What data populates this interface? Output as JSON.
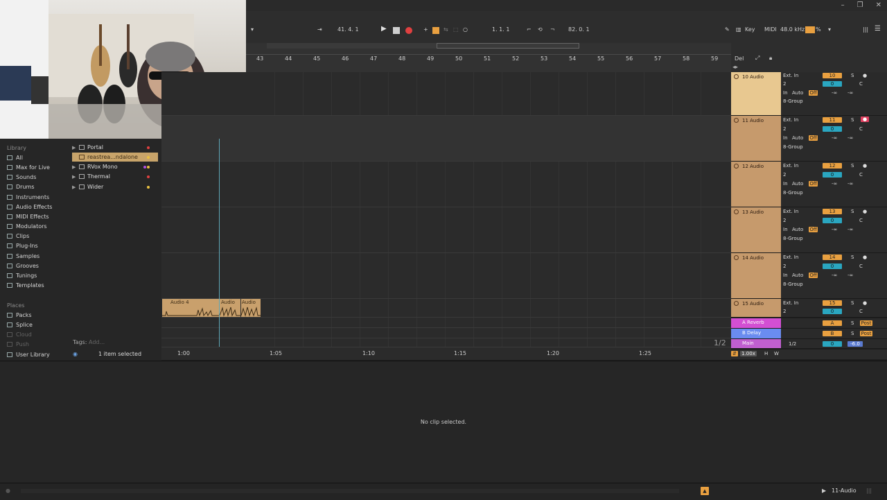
{
  "toolbar": {
    "position": "41.  4.  1",
    "loop_start": "1.  1.  1",
    "tempo_display": "82.  0.  1",
    "key_label": "Key",
    "midi_label": "MIDI",
    "sample_rate": "48.0 kHz",
    "cpu": "%"
  },
  "ruler": {
    "bars": [
      "43",
      "44",
      "45",
      "46",
      "47",
      "48",
      "49",
      "50",
      "51",
      "52",
      "53",
      "54",
      "55",
      "56",
      "57",
      "58",
      "59"
    ]
  },
  "browser": {
    "library_label": "Library",
    "categories": [
      "All",
      "Max for Live",
      "Sounds",
      "Drums",
      "Instruments",
      "Audio Effects",
      "MIDI Effects",
      "Modulators",
      "Clips",
      "Plug-Ins",
      "Samples",
      "Grooves",
      "Tunings",
      "Templates"
    ],
    "places_label": "Places",
    "places": [
      "Packs",
      "Splice",
      "Cloud",
      "Push",
      "User Library"
    ],
    "files": [
      "Portal",
      "reastrea...ndalone",
      "RVox Mono",
      "Thermal",
      "Wider"
    ],
    "tags_label": "Tags:",
    "tags_placeholder": "Add...",
    "selection_status": "1 item selected"
  },
  "tracks": [
    {
      "name": "10 Audio",
      "input": "Ext. In",
      "channel": "2",
      "group": "8-Group",
      "num": "10"
    },
    {
      "name": "11 Audio",
      "input": "Ext. In",
      "channel": "2",
      "group": "8-Group",
      "num": "11"
    },
    {
      "name": "12 Audio",
      "input": "Ext. In",
      "channel": "2",
      "group": "8-Group",
      "num": "12"
    },
    {
      "name": "13 Audio",
      "input": "Ext. In",
      "channel": "2",
      "group": "8-Group",
      "num": "13"
    },
    {
      "name": "14 Audio",
      "input": "Ext. In",
      "channel": "2",
      "group": "8-Group",
      "num": "14"
    },
    {
      "name": "15 Audio",
      "input": "Ext. In",
      "channel": "2",
      "num": "15"
    }
  ],
  "track_controls": {
    "in": "In",
    "auto": "Auto",
    "off": "Off",
    "inf": "-∞",
    "solo": "S",
    "center": "C",
    "zero": "0"
  },
  "returns": [
    {
      "name": "A Reverb",
      "letter": "A",
      "post": "Post",
      "color": "#d34fd3"
    },
    {
      "name": "B Delay",
      "letter": "B",
      "post": "Post",
      "color": "#6a8cf0"
    },
    {
      "name": "Main",
      "page": "1/2",
      "vol": "-6.0",
      "color": "#c05fd0"
    }
  ],
  "arrange_header": {
    "del": "Del"
  },
  "clip": {
    "name": "Audio 4",
    "name2": "Audio",
    "name3": "Audio"
  },
  "page_indicator": "1/2",
  "timeline": [
    "1:00",
    "1:05",
    "1:10",
    "1:15",
    "1:20",
    "1:25"
  ],
  "zoom": "1.00x",
  "hw": {
    "h": "H",
    "w": "W"
  },
  "detail_message": "No clip selected.",
  "status": {
    "track": "11-Audio"
  }
}
